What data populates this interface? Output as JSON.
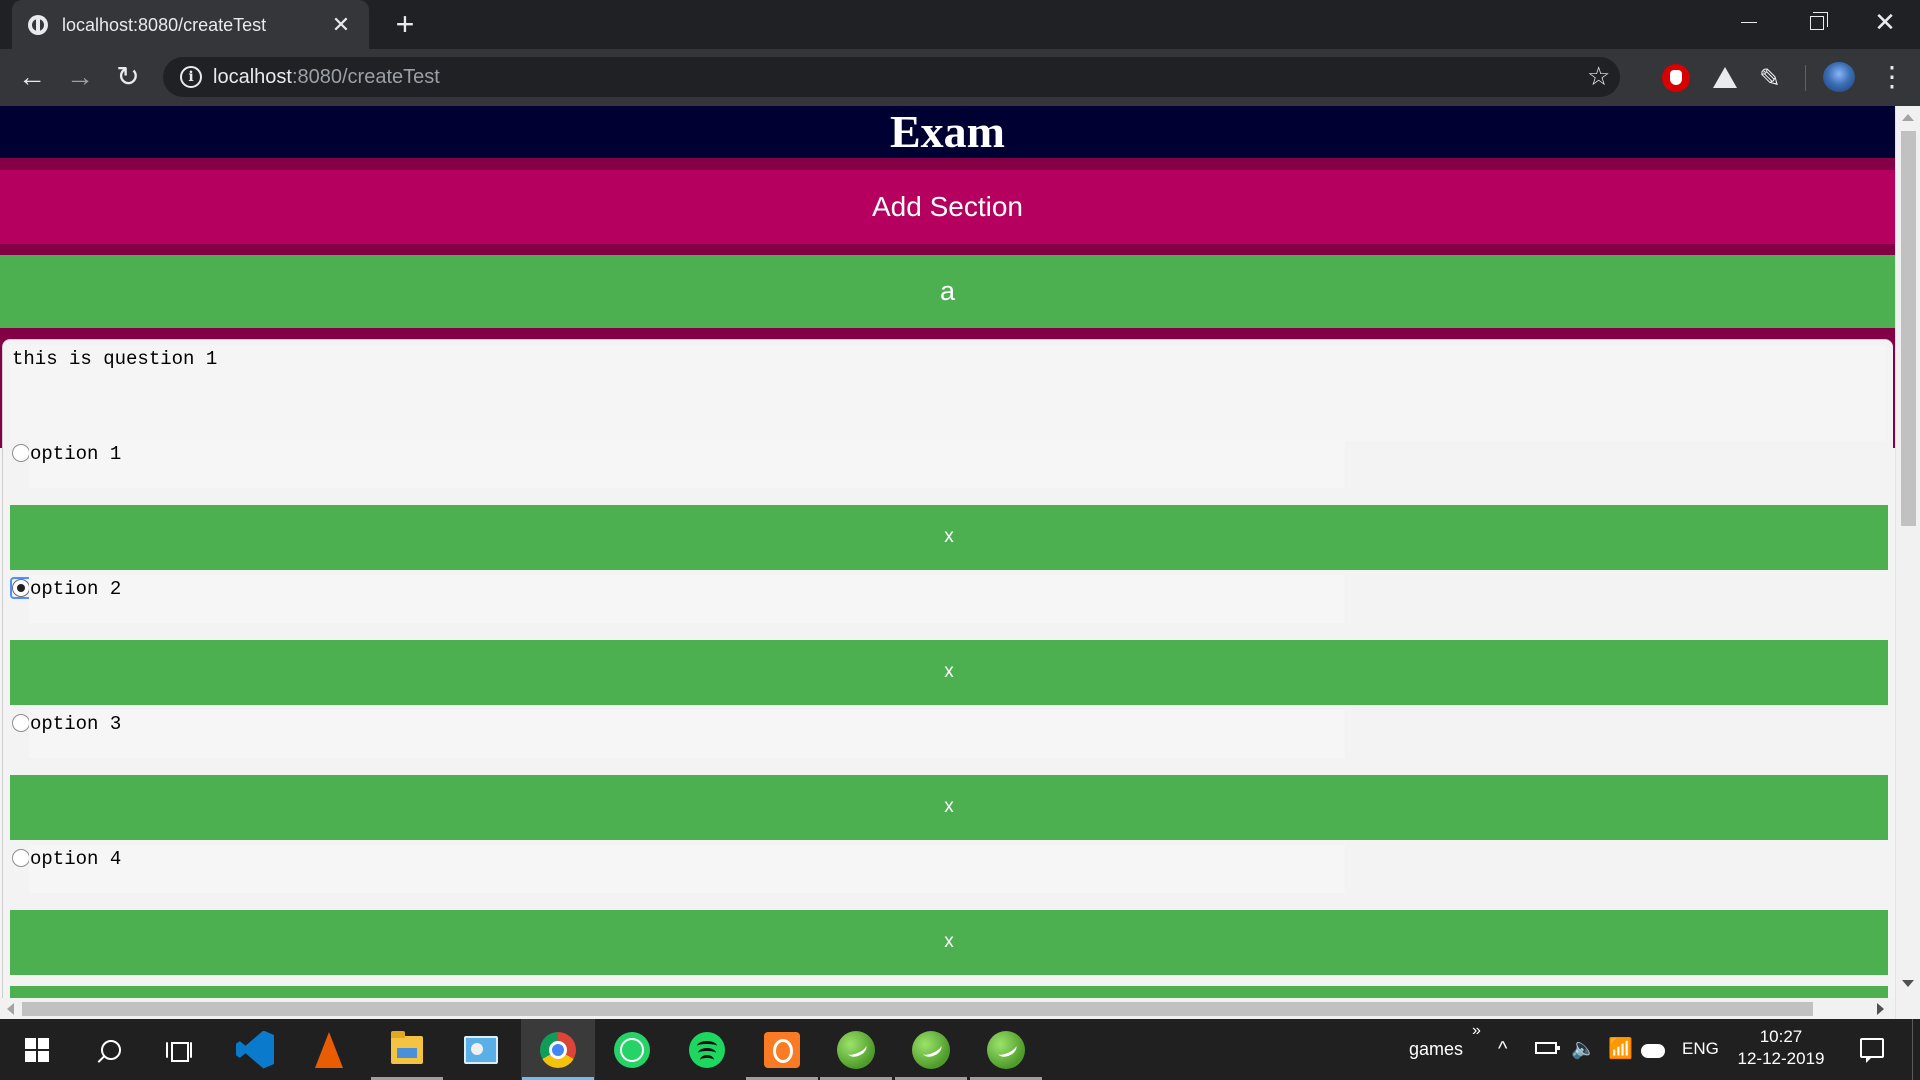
{
  "browser": {
    "tab_title": "localhost:8080/createTest",
    "tab_close": "✕",
    "new_tab": "+",
    "url_host": "localhost",
    "url_rest": ":8080/createTest",
    "icons": [
      "globe-icon",
      "back-arrow-icon",
      "forward-arrow-icon",
      "reload-icon",
      "info-icon",
      "star-icon",
      "adblock-icon",
      "drive-icon",
      "pen-icon",
      "profile-avatar",
      "menu-dots-icon"
    ]
  },
  "page": {
    "header_title": "Exam",
    "add_section_label": "Add Section",
    "section_name": "a",
    "question_text": "this is question 1",
    "options": [
      {
        "label": "option 1",
        "checked": false,
        "delete_label": "x"
      },
      {
        "label": "option 2",
        "checked": true,
        "delete_label": "x"
      },
      {
        "label": "option 3",
        "checked": false,
        "delete_label": "x"
      },
      {
        "label": "option 4",
        "checked": false,
        "delete_label": "x"
      }
    ],
    "colors": {
      "header": "#000033",
      "band": "#840046",
      "add_section": "#b5005f",
      "green": "#4caf50"
    }
  },
  "taskbar": {
    "apps": [
      "start-icon",
      "search-icon",
      "task-view-icon",
      "vscode-icon",
      "vlc-icon",
      "file-explorer-icon",
      "control-panel-icon",
      "chrome-icon",
      "whatsapp-icon",
      "spotify-icon",
      "xampp-icon",
      "spring-tool-icon",
      "spring-tool-icon",
      "spring-tool-icon"
    ],
    "toolbar_label": "games",
    "toolbar_chevron": "»",
    "language": "ENG",
    "time": "10:27",
    "date": "12-12-2019"
  }
}
